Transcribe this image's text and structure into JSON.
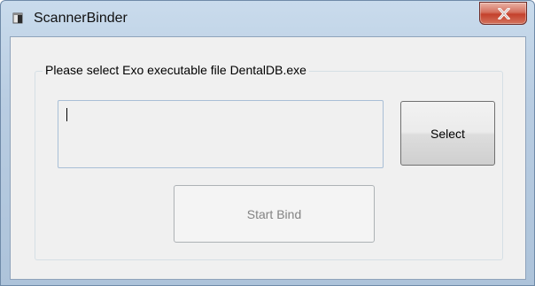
{
  "window": {
    "title": "ScannerBinder",
    "close_icon": "close-icon",
    "app_icon": "scanner-binder-app-icon"
  },
  "group": {
    "legend": "Please select Exo executable file DentalDB.exe"
  },
  "path_field": {
    "value": ""
  },
  "buttons": {
    "select_label": "Select",
    "start_bind_label": "Start Bind",
    "start_bind_enabled": false
  },
  "colors": {
    "close_button_red": "#c4412c",
    "frame_blue": "#b9cde2",
    "client_bg": "#f0f0f0",
    "disabled_text": "#838383"
  }
}
